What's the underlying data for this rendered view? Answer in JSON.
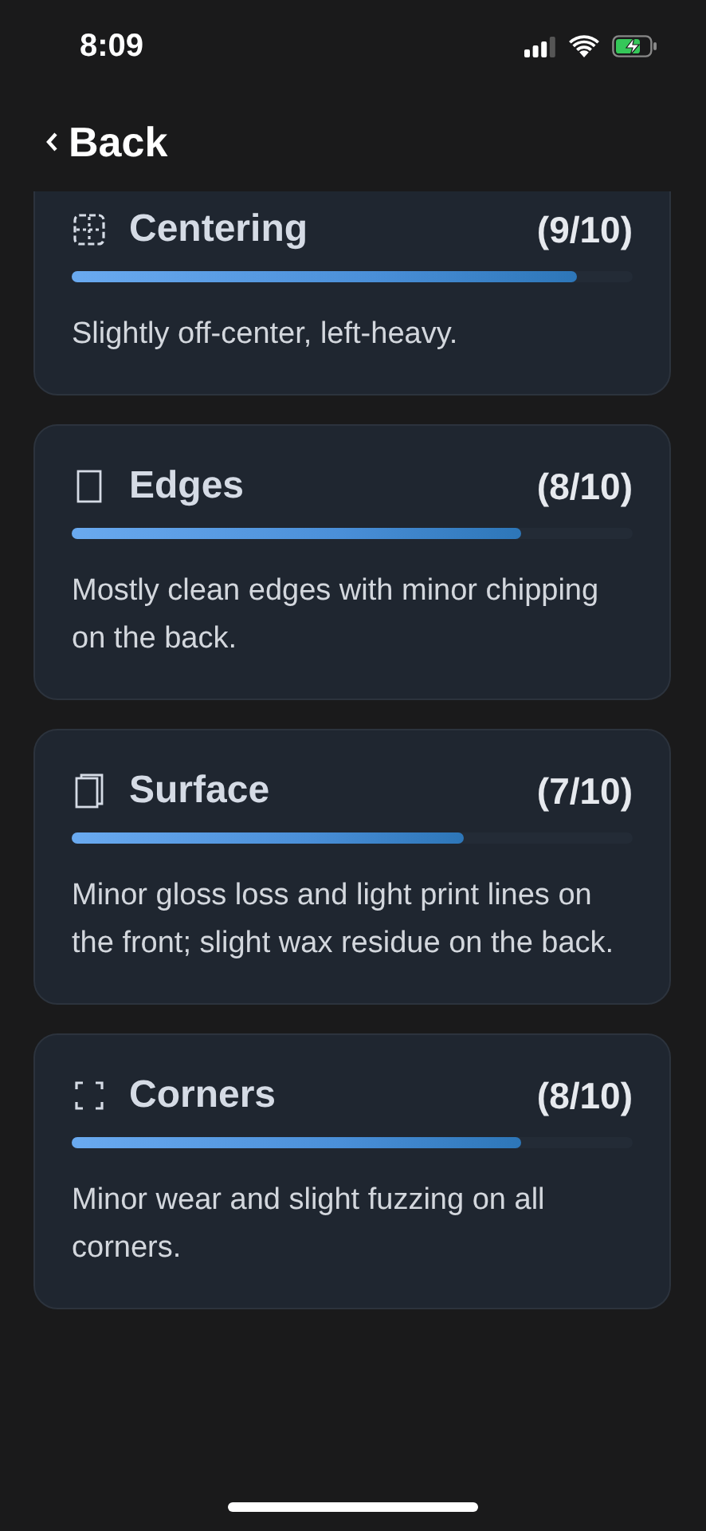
{
  "status_bar": {
    "time": "8:09"
  },
  "nav": {
    "back_label": "Back"
  },
  "categories": [
    {
      "kind": "centering",
      "title": "Centering",
      "score": "(9/10)",
      "level": 0.9,
      "description": "Slightly off-center, left-heavy."
    },
    {
      "kind": "edges",
      "title": "Edges",
      "score": "(8/10)",
      "level": 0.8,
      "description": "Mostly clean edges with minor chipping on the back."
    },
    {
      "kind": "surface",
      "title": "Surface",
      "score": "(7/10)",
      "level": 0.7,
      "description": "Minor gloss loss and light print lines on the front; slight wax residue on the back."
    },
    {
      "kind": "corners",
      "title": "Corners",
      "score": "(8/10)",
      "level": 0.8,
      "description": "Minor wear and slight fuzzing on all corners."
    }
  ]
}
